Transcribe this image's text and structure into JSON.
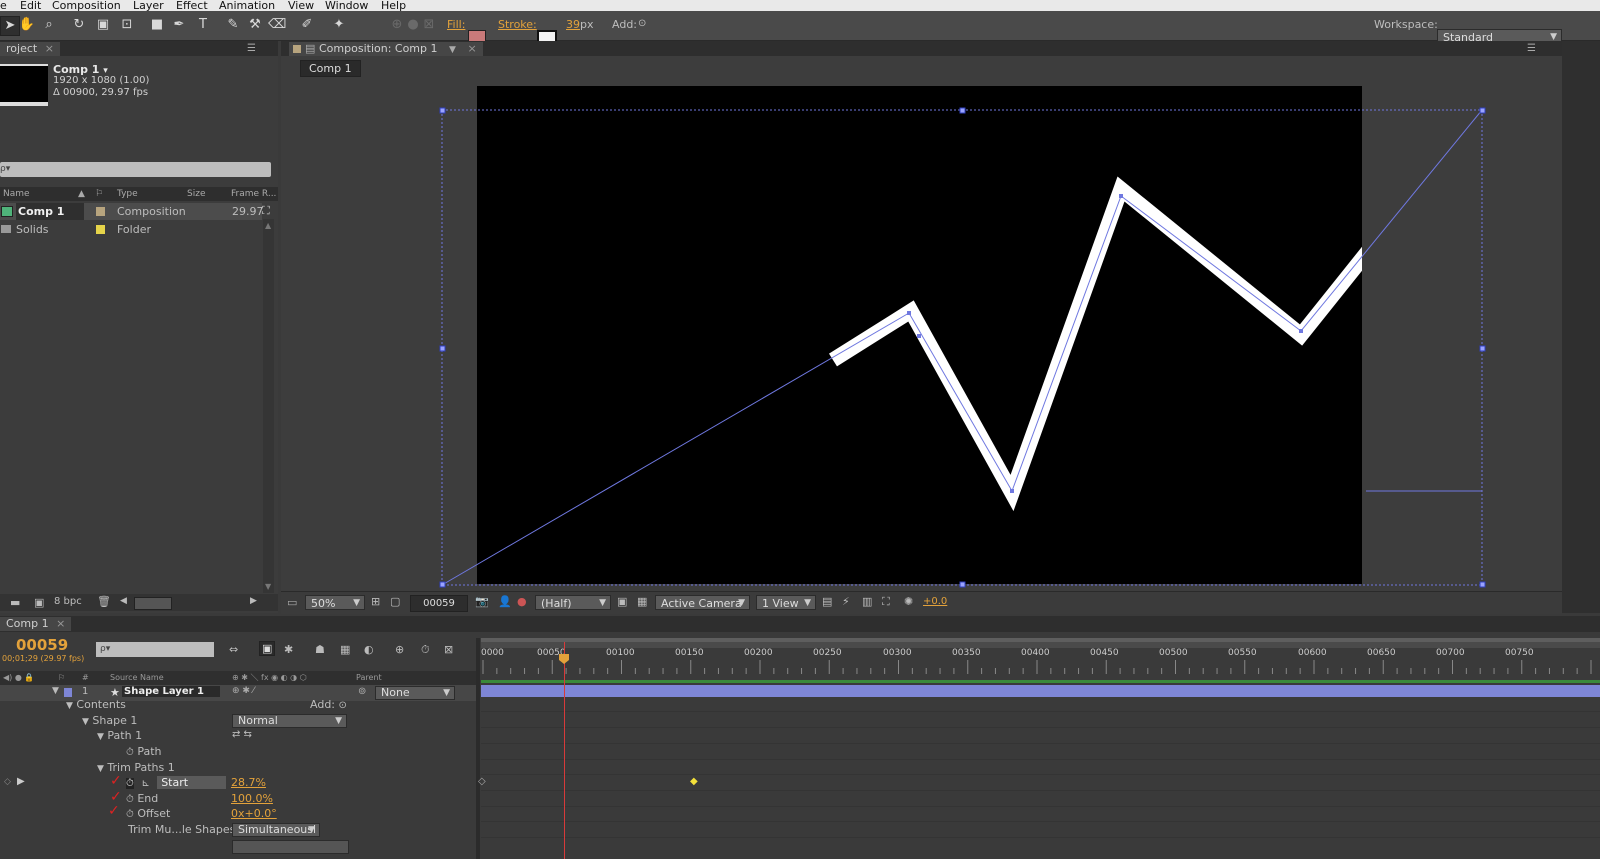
{
  "menu": [
    "e",
    "Edit",
    "Composition",
    "Layer",
    "Effect",
    "Animation",
    "View",
    "Window",
    "Help"
  ],
  "toolbar": {
    "fill_label": "Fill:",
    "stroke_label": "Stroke:",
    "stroke_width": "39",
    "stroke_unit": "px",
    "add_label": "Add:",
    "workspace_label": "Workspace:",
    "workspace_value": "Standard"
  },
  "project": {
    "tab": "roject",
    "comp_name": "Comp 1",
    "comp_arrow": "▾",
    "comp_size": "1920 x 1080 (1.00)",
    "comp_duration": "Δ 00900, 29.97 fps",
    "search_placeholder": "ρ▾",
    "columns": [
      "Name",
      "Type",
      "Size",
      "Frame R..."
    ],
    "items": [
      {
        "name": "Comp 1",
        "type": "Composition",
        "size": "",
        "frame_rate": "29.97",
        "label_color": "#b7a47e"
      },
      {
        "name": "Solids",
        "type": "Folder",
        "size": "",
        "frame_rate": "",
        "label_color": "#e6d44a"
      }
    ],
    "bpc": "8 bpc"
  },
  "composition": {
    "panel_title": "Composition: Comp 1",
    "breadcrumb": "Comp 1",
    "zoom": "50%",
    "timecode": "00059",
    "resolution": "(Half)",
    "camera": "Active Camera",
    "views": "1 View",
    "exposure": "+0.0"
  },
  "timeline": {
    "tab": "Comp 1",
    "current_frame": "00059",
    "current_time": "00;01;29 (29.97 fps)",
    "search_placeholder": "ρ▾",
    "ruler": [
      "0000",
      "00050",
      "00100",
      "00150",
      "00200",
      "00250",
      "00300",
      "00350",
      "00400",
      "00450",
      "00500",
      "00550",
      "00600",
      "00650",
      "00700",
      "00750"
    ],
    "col_source_name": "Source Name",
    "col_parent": "Parent",
    "col_hash": "#",
    "layer": {
      "index": "1",
      "name": "Shape Layer 1",
      "parent": "None"
    },
    "props": {
      "contents": "Contents",
      "add": "Add:",
      "shape": "Shape 1",
      "blend_mode": "Normal",
      "path_group": "Path 1",
      "path": "Path",
      "trim_group": "Trim Paths 1",
      "start_label": "Start",
      "start_value": "28.7%",
      "end_label": "End",
      "end_value": "100.0%",
      "offset_label": "Offset",
      "offset_value": "0x+0.0°",
      "trim_multiple_label": "Trim Mu...le Shapes",
      "trim_multiple_value": "Simultaneousl"
    }
  },
  "colors": {
    "accent": "#e3a23b",
    "layer_bar": "#7e86d6",
    "path_blue": "#6f78e0",
    "playhead": "#d83a3a",
    "keyframe": "#f4e13a"
  }
}
